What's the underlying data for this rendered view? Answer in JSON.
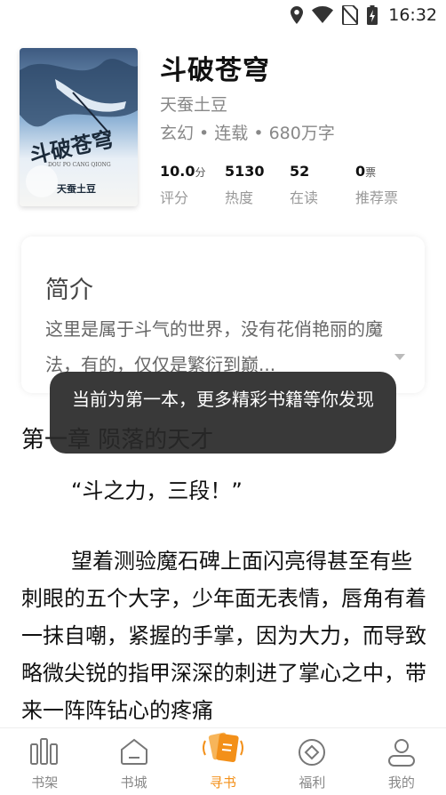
{
  "status_bar": {
    "time": "16:32",
    "icons": [
      "location-icon",
      "wifi-icon",
      "no-sim-icon",
      "battery-charging-icon"
    ]
  },
  "book": {
    "title": "斗破苍穹",
    "author": "天蚕土豆",
    "meta": "玄幻 • 连载 • 680万字",
    "cover": {
      "title_text": "斗破苍穹",
      "author_text": "天蚕土豆",
      "subtitle_text": "DOU PO CANG QIONG"
    },
    "stats": [
      {
        "value": "10.0",
        "unit": "分",
        "label": "评分"
      },
      {
        "value": "5130",
        "unit": "",
        "label": "热度"
      },
      {
        "value": "52",
        "unit": "",
        "label": "在读"
      },
      {
        "value": "0",
        "unit": "票",
        "label": "推荐票"
      }
    ]
  },
  "intro": {
    "title": "简介",
    "text": "这里是属于斗气的世界，没有花俏艳丽的魔法，有的，仅仅是繁衍到巅..."
  },
  "chapter": {
    "title": "第一章 陨落的天才",
    "quote": "“斗之力，三段！”",
    "paragraph": "望着测验魔石碑上面闪亮得甚至有些刺眼的五个大字，少年面无表情，唇角有着一抹自嘲，紧握的手掌，因为大力，而导致略微尖锐的指甲深深的刺进了掌心之中，带来一阵阵钻心的疼痛"
  },
  "toast": {
    "message": "当前为第一本，更多精彩书籍等你发现"
  },
  "bottom_nav": {
    "items": [
      {
        "label": "书架",
        "icon": "bookshelf-icon",
        "active": false
      },
      {
        "label": "书城",
        "icon": "bookstore-icon",
        "active": false
      },
      {
        "label": "寻书",
        "icon": "find-book-icon",
        "active": true
      },
      {
        "label": "福利",
        "icon": "benefits-icon",
        "active": false
      },
      {
        "label": "我的",
        "icon": "profile-icon",
        "active": false
      }
    ]
  },
  "colors": {
    "accent": "#f39019",
    "text_primary": "#111111",
    "text_secondary": "#888888",
    "toast_bg": "#282828"
  }
}
